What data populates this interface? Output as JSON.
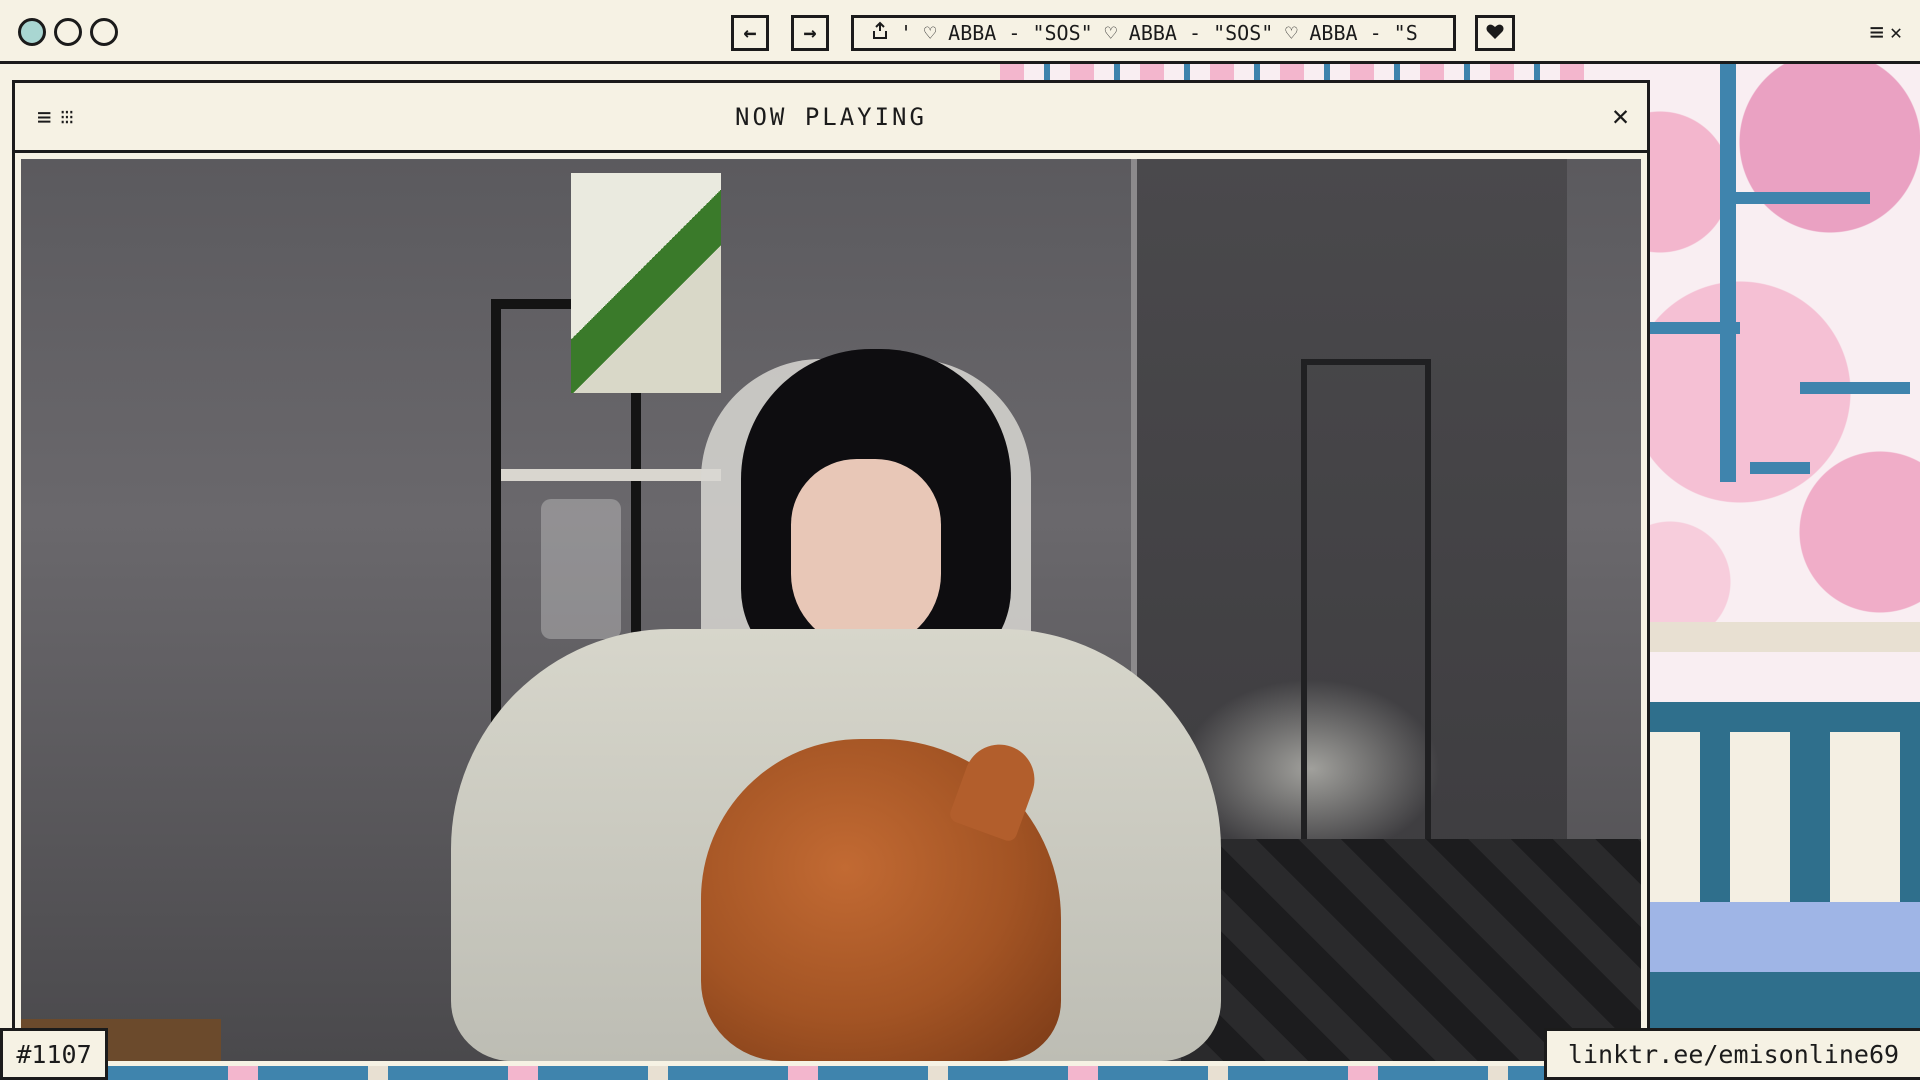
{
  "browser": {
    "back_icon": "←",
    "forward_icon": "→",
    "url_icon": "share-icon",
    "url_text": "' ♡ ABBA - \"SOS\" ♡ ABBA - \"SOS\" ♡ ABBA - \"S",
    "favorite_icon": "heart-icon",
    "menu_icon": "≡",
    "close_icon": "✕"
  },
  "window": {
    "title": "NOW PLAYING",
    "menu_icon": "≡",
    "grid_icon": "⁝⁝⁝",
    "close_icon": "✕"
  },
  "overlay": {
    "counter": "#1107",
    "link": "linktr.ee/emisonline69"
  },
  "colors": {
    "frame": "#1b1b1b",
    "panel": "#f6f2e4",
    "accent_teal": "#a9d6d2",
    "blossom_pink": "#f3b6cd",
    "branch_blue": "#3f84ad"
  }
}
